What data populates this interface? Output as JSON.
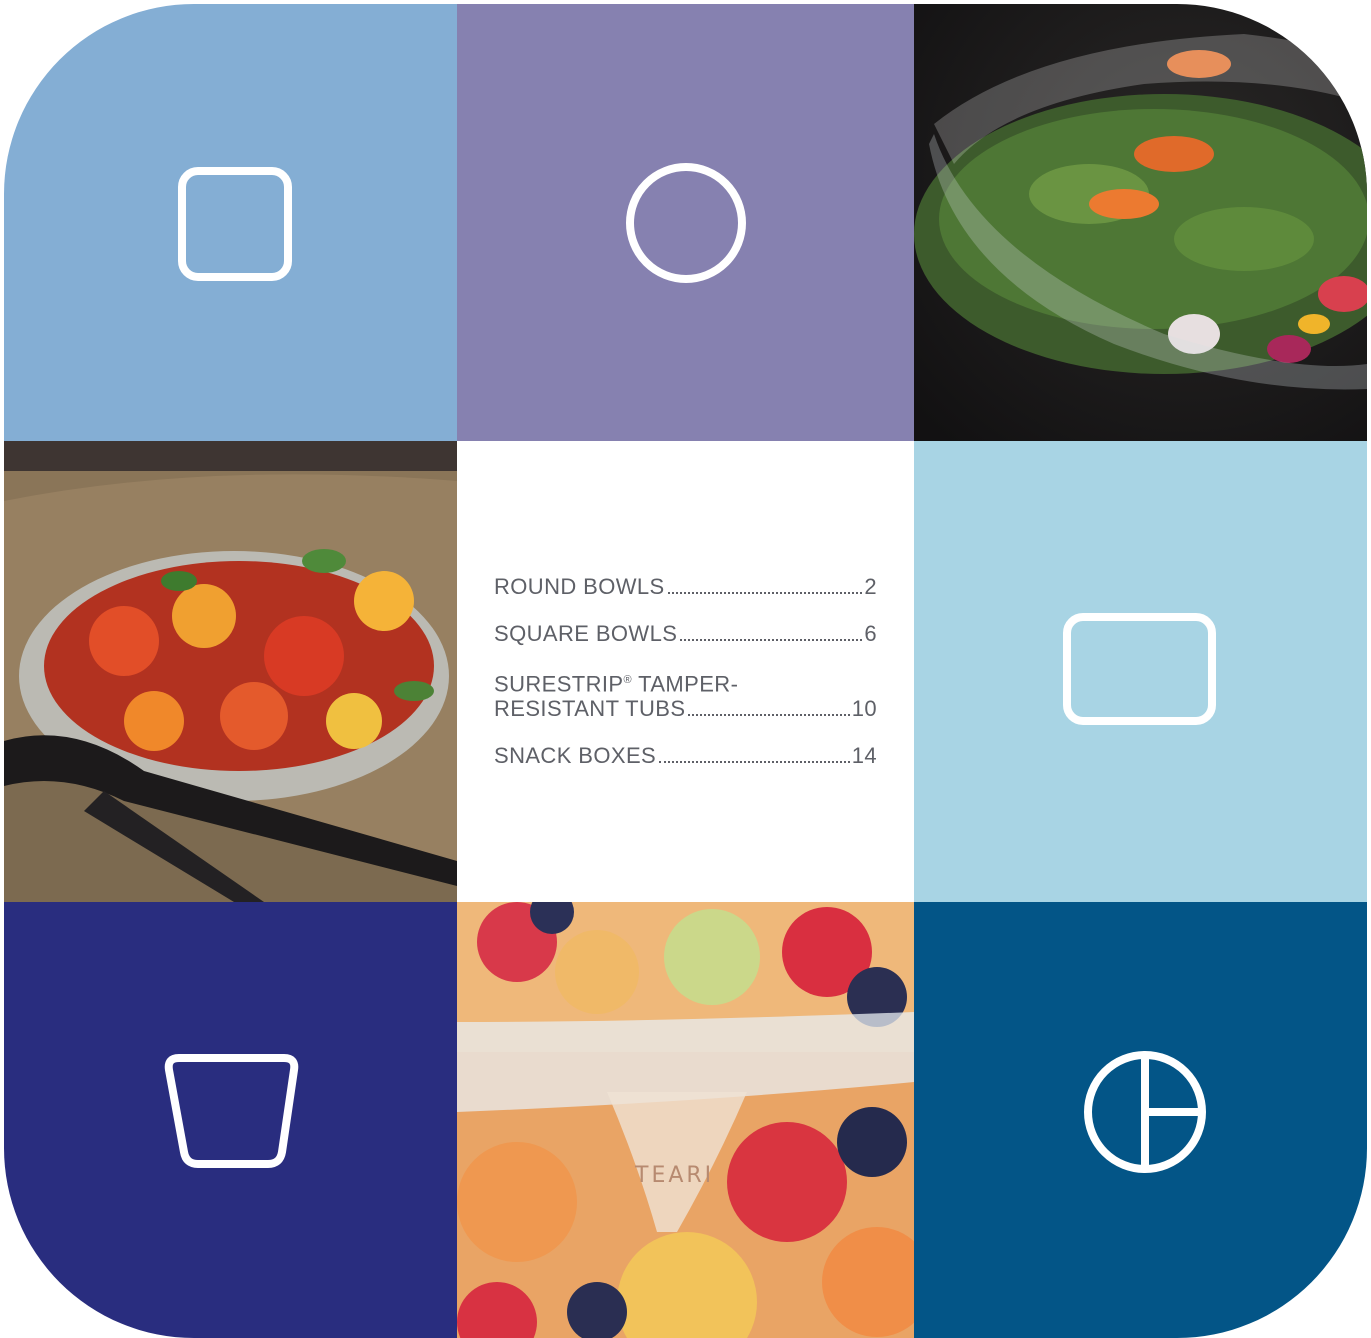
{
  "colors": {
    "light_blue": "#84aed4",
    "purple": "#8681b0",
    "pale_blue": "#a8d4e4",
    "navy": "#292d7f",
    "dark_blue": "#035587",
    "text": "#5e6067"
  },
  "icons": [
    "square-bowl-icon",
    "round-bowl-icon",
    "rectangle-tub-icon",
    "tapered-cup-icon",
    "divided-round-container-icon"
  ],
  "photos": [
    "green-salad-bowl-photo",
    "tomato-salad-bowl-photo",
    "fruit-salad-container-photo"
  ],
  "photo_text": {
    "lid_tab": "TEARI"
  },
  "toc": {
    "round_bowls": {
      "label": "ROUND BOWLS",
      "page": "2"
    },
    "square_bowls": {
      "label": "SQUARE BOWLS",
      "page": "6"
    },
    "tubs": {
      "label_line1": "SURESTRIP",
      "mark": "®",
      "label_line1_rest": " TAMPER-",
      "label_line2": "RESISTANT TUBS",
      "page": "10"
    },
    "snack_boxes": {
      "label": "SNACK BOXES",
      "page": "14"
    }
  }
}
